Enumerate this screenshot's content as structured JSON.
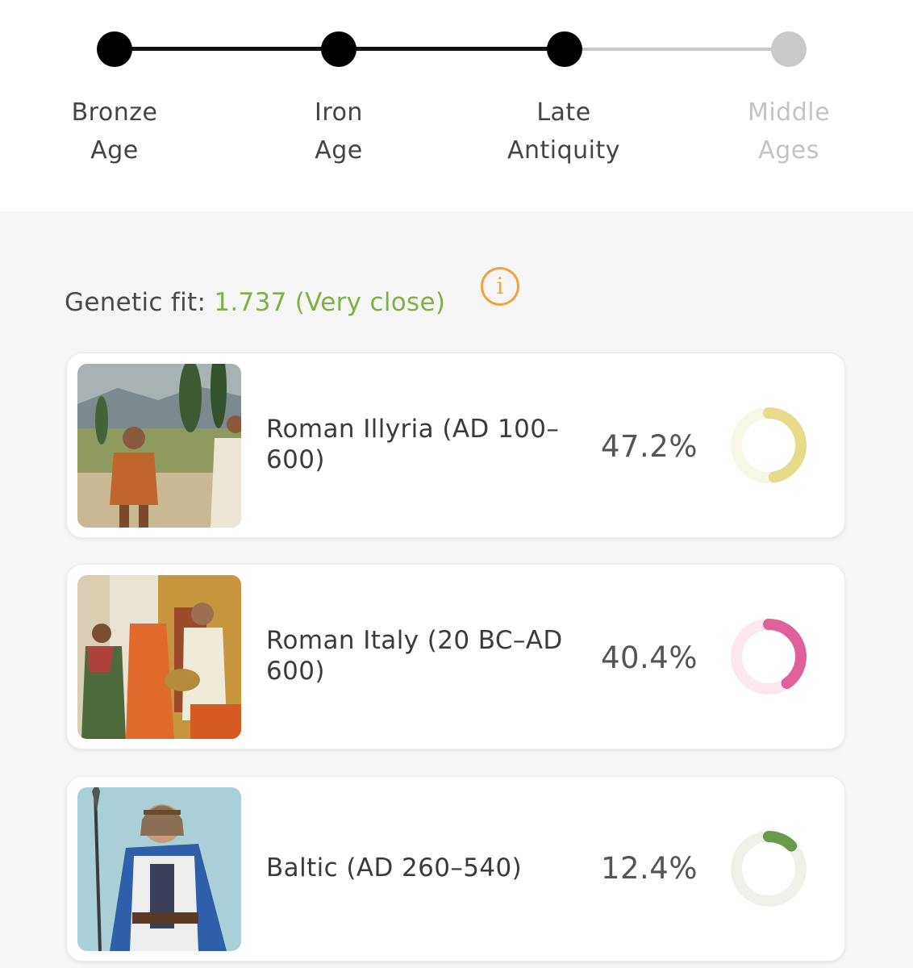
{
  "timeline": {
    "steps": [
      {
        "line1": "Bronze",
        "line2": "Age",
        "state": "done"
      },
      {
        "line1": "Iron",
        "line2": "Age",
        "state": "done"
      },
      {
        "line1": "Late",
        "line2": "Antiquity",
        "state": "current"
      },
      {
        "line1": "Middle",
        "line2": "Ages",
        "state": "todo"
      }
    ]
  },
  "fit": {
    "label": "Genetic fit:",
    "value": "1.737 (Very close)",
    "info_icon": "info-icon"
  },
  "populations": [
    {
      "name": "Roman Illyria (AD 100–600)",
      "percent_label": "47.2%",
      "percent": 47.2,
      "color": "#e7dc8a",
      "track": "#f8f6e8",
      "image_icon": "roman-illyria-painting"
    },
    {
      "name": "Roman Italy (20 BC–AD 600)",
      "percent_label": "40.4%",
      "percent": 40.4,
      "color": "#e0609a",
      "track": "#fbe8ef",
      "image_icon": "roman-italy-painting"
    },
    {
      "name": "Baltic (AD 260–540)",
      "percent_label": "12.4%",
      "percent": 12.4,
      "color": "#6c9a4a",
      "track": "#eef1ea",
      "image_icon": "baltic-warrior-painting"
    }
  ]
}
